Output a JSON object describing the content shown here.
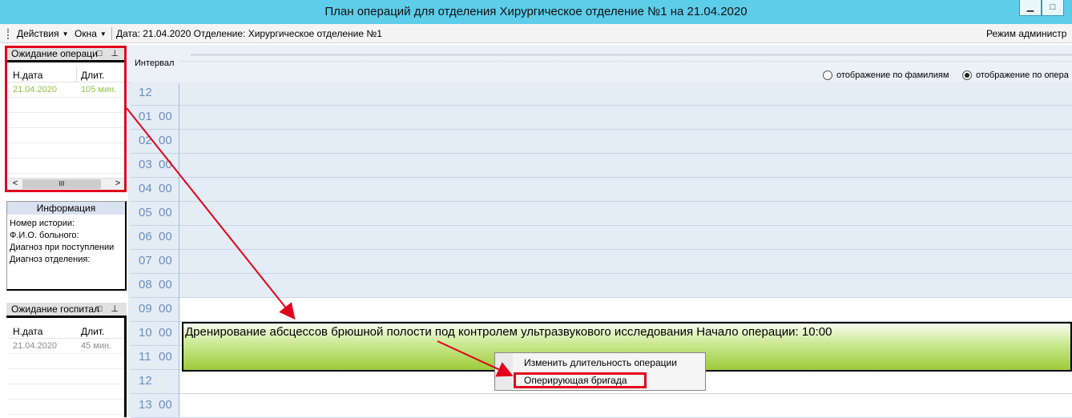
{
  "window": {
    "title": "План операций для отделения Хирургическое отделение №1 на 21.04.2020",
    "minimize_glyph": "▁",
    "maximize_glyph": "□"
  },
  "menu": {
    "actions": "Действия",
    "windows": "Окна",
    "status": "Дата: 21.04.2020 Отделение: Хирургическое отделение №1",
    "mode": "Режим администр"
  },
  "waiting_operations": {
    "title": "Ожидание операци",
    "columns": [
      "Н.дата",
      "Длит."
    ],
    "rows": [
      {
        "date": "21.04.2020",
        "duration": "105 мин.",
        "color": "#8dc63f"
      }
    ],
    "scroll_left": "<",
    "scroll_thumb": "III",
    "scroll_right": ">"
  },
  "info": {
    "title": "Информация",
    "lines": [
      "Номер истории:",
      "Ф.И.О. больного:",
      "Диагноз при поступлении",
      "Диагноз отделения:"
    ]
  },
  "waiting_hospital": {
    "title": "Ожидание госпитал",
    "columns": [
      "Н.дата",
      "Длит."
    ],
    "rows": [
      {
        "date": "21.04.2020",
        "duration": "45 мин.",
        "color": "#8a8a8a"
      }
    ]
  },
  "scheduler": {
    "interval_label": "Интервал",
    "view_by_surname": "отображение по фамилиям",
    "view_by_operation": "отображение по опера",
    "hours": [
      {
        "h": "12",
        "m": ""
      },
      {
        "h": "01",
        "m": "00"
      },
      {
        "h": "02",
        "m": "00"
      },
      {
        "h": "03",
        "m": "00"
      },
      {
        "h": "04",
        "m": "00"
      },
      {
        "h": "05",
        "m": "00"
      },
      {
        "h": "06",
        "m": "00"
      },
      {
        "h": "07",
        "m": "00"
      },
      {
        "h": "08",
        "m": "00"
      },
      {
        "h": "09",
        "m": "00"
      },
      {
        "h": "10",
        "m": "00"
      },
      {
        "h": "11",
        "m": "00"
      },
      {
        "h": "12",
        "m": ""
      },
      {
        "h": "13",
        "m": "00"
      }
    ],
    "operation": "Дренирование абсцессов брюшной полости под контролем ультразвукового исследования Начало операции: 10:00"
  },
  "context_menu": {
    "change_duration": "Изменить длительность операции",
    "operating_team": "Оперирующая бригада"
  },
  "colors": {
    "titlebar": "#5dcdea",
    "highlight": "#e2001a",
    "slot_off": "#e4ecf6",
    "hour_text": "#6c8fb8"
  }
}
